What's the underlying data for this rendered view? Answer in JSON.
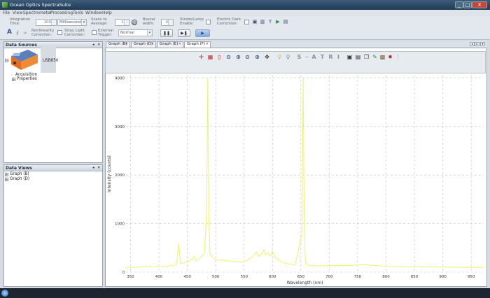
{
  "window": {
    "title": "Ocean Optics SpectraSuite",
    "minimize": "_",
    "maximize": "□",
    "close": "✕"
  },
  "menu": [
    "File",
    "View",
    "Spectrometer",
    "Processing",
    "Tools",
    "Window",
    "Help"
  ],
  "toolbar": {
    "integration_time_label": "Integration Time:",
    "integration_time_value": "100",
    "integration_unit": "Milliseconds",
    "scans_label": "Scans to Average:",
    "scans_value": "1",
    "boxcar_label": "Boxcar width:",
    "boxcar_value": "0",
    "strobe_label": "Strobe/Lamp Enable:",
    "dark_label": "Electric Dark Correction:",
    "nonlinearity_label": "Nonlinearity Correction:",
    "stray_label": "Stray Light Correction:",
    "trigger_label": "External Trigger:",
    "trigger_value": "Normal",
    "pause_label": "❚❚",
    "step_label": "▶❚",
    "play_label": "▶",
    "font_icon_label": "A"
  },
  "data_sources": {
    "title": "Data Sources",
    "pin": "◂",
    "close": "✕",
    "device_label": "USB650",
    "items": [
      "Acquisition",
      "Properties"
    ]
  },
  "data_views": {
    "title": "Data Views",
    "pin": "◂",
    "close": "✕",
    "items": [
      "Graph (B)",
      "Graph (D)"
    ]
  },
  "tabs": [
    {
      "label": "Graph (B)",
      "selected": false
    },
    {
      "label": "Graph (D)",
      "selected": false
    },
    {
      "label": "Graph (E)",
      "selected": false
    },
    {
      "label": "Graph (F)",
      "selected": true
    }
  ],
  "graph_toolbar_letters": [
    "S",
    "A",
    "T",
    "R",
    "I"
  ],
  "colors": {
    "spectrum_line": "#f2f06a",
    "accent": "#2c52a8",
    "titlebar": "#1f3a55"
  },
  "chart_data": {
    "type": "line",
    "xlabel": "Wavelength (nm)",
    "ylabel": "Intensity (counts)",
    "xlim": [
      342,
      972
    ],
    "ylim": [
      0,
      4050
    ],
    "xticks": [
      350,
      400,
      450,
      500,
      550,
      600,
      650,
      700,
      750,
      800,
      850,
      900,
      950
    ],
    "yticks": [
      0,
      1000,
      2000,
      3000,
      4000
    ],
    "ytick_labels": [
      "0",
      "1000",
      "2000",
      "3000",
      "4000"
    ],
    "grid": true,
    "series": [
      {
        "x": [
          342,
          380,
          420,
          430,
          433,
          435,
          438,
          450,
          458,
          462,
          465,
          470,
          480,
          484,
          486,
          488,
          490,
          495,
          500,
          520,
          540,
          548,
          555,
          565,
          572,
          575,
          580,
          585,
          588,
          592,
          596,
          600,
          604,
          608,
          612,
          616,
          620,
          628,
          640,
          652,
          654,
          656,
          658,
          660,
          665,
          680,
          700,
          740,
          760,
          800,
          850,
          900,
          950,
          972
        ],
        "y": [
          95,
          110,
          130,
          150,
          350,
          600,
          180,
          210,
          260,
          330,
          230,
          260,
          380,
          1200,
          4000,
          1100,
          380,
          300,
          260,
          230,
          210,
          210,
          240,
          320,
          420,
          320,
          360,
          460,
          350,
          400,
          330,
          430,
          320,
          280,
          240,
          210,
          190,
          170,
          150,
          800,
          4000,
          900,
          200,
          160,
          140,
          130,
          135,
          140,
          155,
          120,
          110,
          105,
          100,
          95
        ]
      }
    ]
  }
}
